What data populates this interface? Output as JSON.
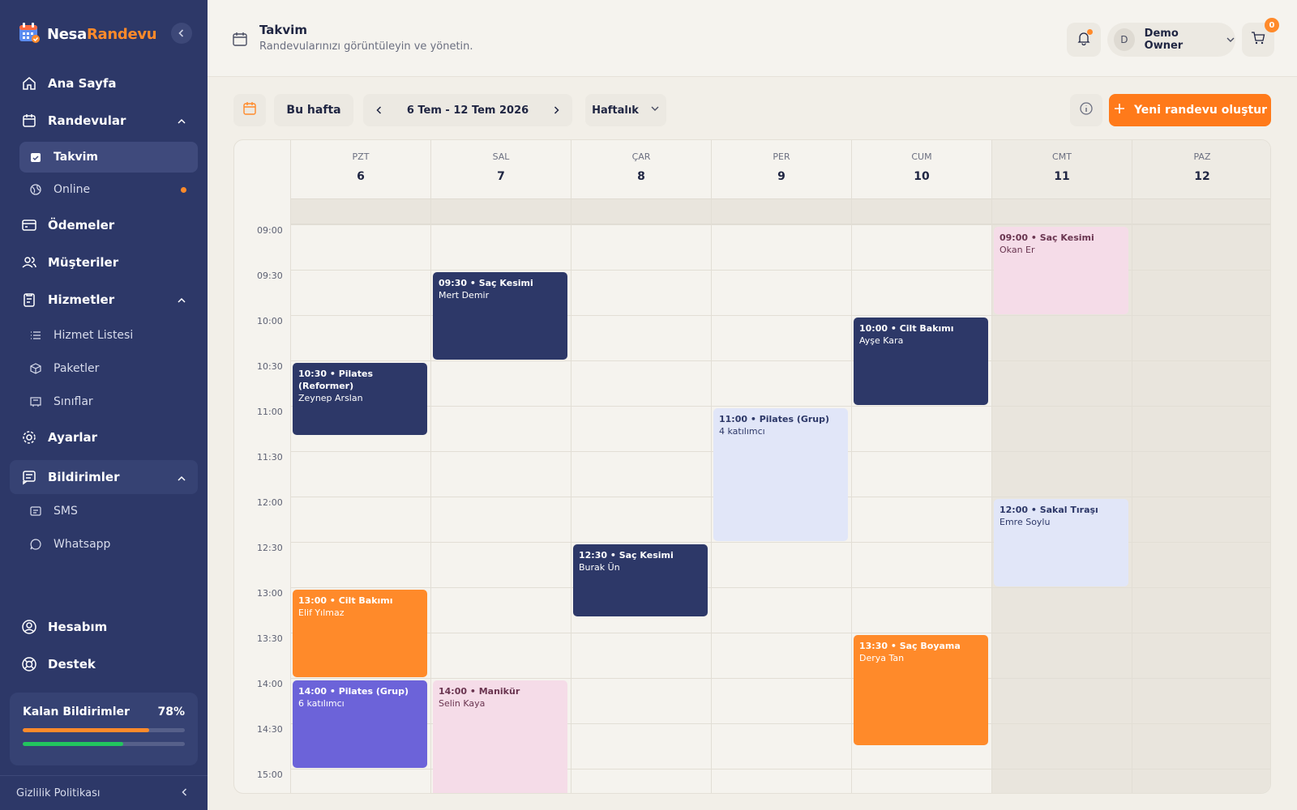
{
  "app": {
    "brand_main": "Nesa",
    "brand_accent": "Randevu"
  },
  "sidebar": {
    "items": [
      {
        "label": "Ana Sayfa",
        "icon": "home-icon"
      },
      {
        "label": "Randevular",
        "icon": "calendar-icon"
      },
      {
        "label": "Ödemeler",
        "icon": "credit-card-icon"
      },
      {
        "label": "Müşteriler",
        "icon": "users-icon"
      },
      {
        "label": "Hizmetler",
        "icon": "clipboard-icon"
      },
      {
        "label": "Ayarlar",
        "icon": "gear-icon"
      },
      {
        "label": "Bildirimler",
        "icon": "message-icon"
      },
      {
        "label": "Hesabım",
        "icon": "account-icon"
      },
      {
        "label": "Destek",
        "icon": "lifebuoy-icon"
      }
    ],
    "sub_randevular": [
      {
        "label": "Takvim"
      },
      {
        "label": "Online"
      }
    ],
    "sub_hizmetler": [
      {
        "label": "Hizmet Listesi"
      },
      {
        "label": "Paketler"
      },
      {
        "label": "Sınıflar"
      }
    ],
    "sub_bildirimler": [
      {
        "label": "SMS"
      },
      {
        "label": "Whatsapp"
      }
    ],
    "quota": {
      "label": "Kalan Bildirimler",
      "percent_text": "78%",
      "bar1": 0.78,
      "bar2": 0.62,
      "bar1_color": "#ff8a2a",
      "bar2_color": "#22c55e"
    },
    "privacy": "Gizlilik Politikası"
  },
  "header": {
    "title": "Takvim",
    "subtitle": "Randevularınızı görüntüleyin ve yönetin.",
    "user_initial": "D",
    "user_name": "Demo Owner",
    "cart_count": "0"
  },
  "toolbar": {
    "this_week": "Bu hafta",
    "range": "6 Tem - 12 Tem 2026",
    "view": "Haftalık",
    "create": "Yeni randevu oluştur"
  },
  "calendar": {
    "days": [
      {
        "name": "PZT",
        "date": "6"
      },
      {
        "name": "SAL",
        "date": "7"
      },
      {
        "name": "ÇAR",
        "date": "8"
      },
      {
        "name": "PER",
        "date": "9"
      },
      {
        "name": "CUM",
        "date": "10"
      },
      {
        "name": "CMT",
        "date": "11"
      },
      {
        "name": "PAZ",
        "date": "12"
      }
    ],
    "times": [
      "09:00",
      "09:30",
      "10:00",
      "10:30",
      "11:00",
      "11:30",
      "12:00",
      "12:30",
      "13:00",
      "13:30",
      "14:00",
      "14:30",
      "15:00"
    ],
    "events": [
      {
        "day": 0,
        "start": "10:30",
        "end": "11:20",
        "title": "10:30 • Pilates (Reformer)",
        "sub": "Zeynep Arslan",
        "style": "navy"
      },
      {
        "day": 0,
        "start": "13:00",
        "end": "14:00",
        "title": "13:00 • Cilt Bakımı",
        "sub": "Elif Yılmaz",
        "style": "orange"
      },
      {
        "day": 0,
        "start": "14:00",
        "end": "15:00",
        "title": "14:00 • Pilates (Grup)",
        "sub": "6 katılımcı",
        "style": "purple"
      },
      {
        "day": 1,
        "start": "09:30",
        "end": "10:30",
        "title": "09:30 • Saç Kesimi",
        "sub": "Mert Demir",
        "style": "navy"
      },
      {
        "day": 1,
        "start": "14:00",
        "end": "15:30",
        "title": "14:00 • Manikür",
        "sub": "Selin Kaya",
        "style": "pink"
      },
      {
        "day": 2,
        "start": "12:30",
        "end": "13:20",
        "title": "12:30 • Saç Kesimi",
        "sub": "Burak Ün",
        "style": "navy"
      },
      {
        "day": 3,
        "start": "11:00",
        "end": "12:30",
        "title": "11:00 • Pilates (Grup)",
        "sub": "4 katılımcı",
        "style": "blue"
      },
      {
        "day": 4,
        "start": "10:00",
        "end": "11:00",
        "title": "10:00 • Cilt Bakımı",
        "sub": "Ayşe Kara",
        "style": "navy"
      },
      {
        "day": 4,
        "start": "13:30",
        "end": "14:45",
        "title": "13:30 • Saç Boyama",
        "sub": "Derya Tan",
        "style": "orange"
      },
      {
        "day": 5,
        "start": "09:00",
        "end": "10:00",
        "title": "09:00 • Saç Kesimi",
        "sub": "Okan Er",
        "style": "pink"
      },
      {
        "day": 5,
        "start": "12:00",
        "end": "13:00",
        "title": "12:00 • Sakal Tıraşı",
        "sub": "Emre Soylu",
        "style": "blue"
      }
    ]
  }
}
